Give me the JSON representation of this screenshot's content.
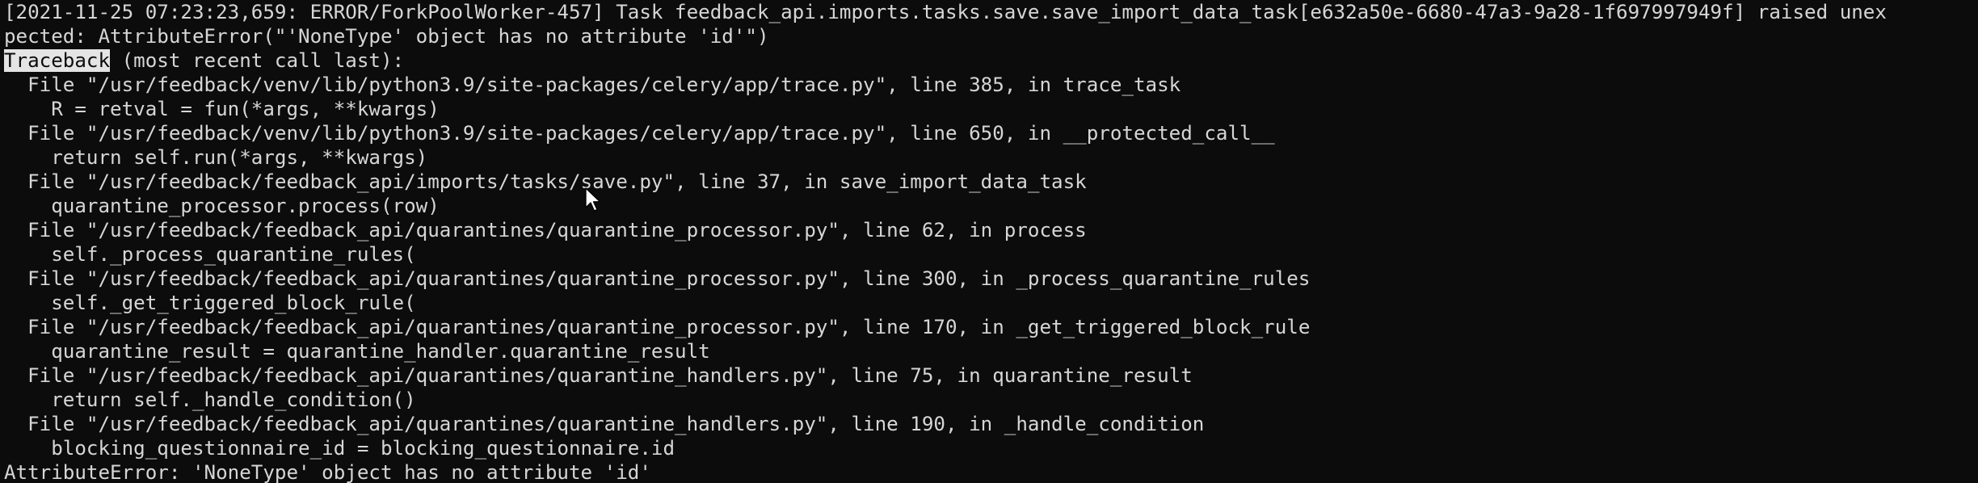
{
  "terminal": {
    "lines": [
      "[2021-11-25 07:23:23,659: ERROR/ForkPoolWorker-457] Task feedback_api.imports.tasks.save.save_import_data_task[e632a50e-6680-47a3-9a28-1f697997949f] raised unex",
      "pected: AttributeError(\"'NoneType' object has no attribute 'id'\")",
      "",
      "  File \"/usr/feedback/venv/lib/python3.9/site-packages/celery/app/trace.py\", line 385, in trace_task",
      "    R = retval = fun(*args, **kwargs)",
      "  File \"/usr/feedback/venv/lib/python3.9/site-packages/celery/app/trace.py\", line 650, in __protected_call__",
      "    return self.run(*args, **kwargs)",
      "  File \"/usr/feedback/feedback_api/imports/tasks/save.py\", line 37, in save_import_data_task",
      "    quarantine_processor.process(row)",
      "  File \"/usr/feedback/feedback_api/quarantines/quarantine_processor.py\", line 62, in process",
      "    self._process_quarantine_rules(",
      "  File \"/usr/feedback/feedback_api/quarantines/quarantine_processor.py\", line 300, in _process_quarantine_rules",
      "    self._get_triggered_block_rule(",
      "  File \"/usr/feedback/feedback_api/quarantines/quarantine_processor.py\", line 170, in _get_triggered_block_rule",
      "    quarantine_result = quarantine_handler.quarantine_result",
      "  File \"/usr/feedback/feedback_api/quarantines/quarantine_handlers.py\", line 75, in quarantine_result",
      "    return self._handle_condition()",
      "  File \"/usr/feedback/feedback_api/quarantines/quarantine_handlers.py\", line 190, in _handle_condition",
      "    blocking_questionnaire_id = blocking_questionnaire.id",
      "AttributeError: 'NoneType' object has no attribute 'id'"
    ],
    "traceback_selected": "Traceback",
    "traceback_rest": " (most recent call last):"
  },
  "colors": {
    "background": "#0c0c0c",
    "text": "#d6d6d6",
    "selection_bg": "#e4e4e4"
  },
  "icons": {
    "cursor": "mouse-pointer-icon"
  }
}
